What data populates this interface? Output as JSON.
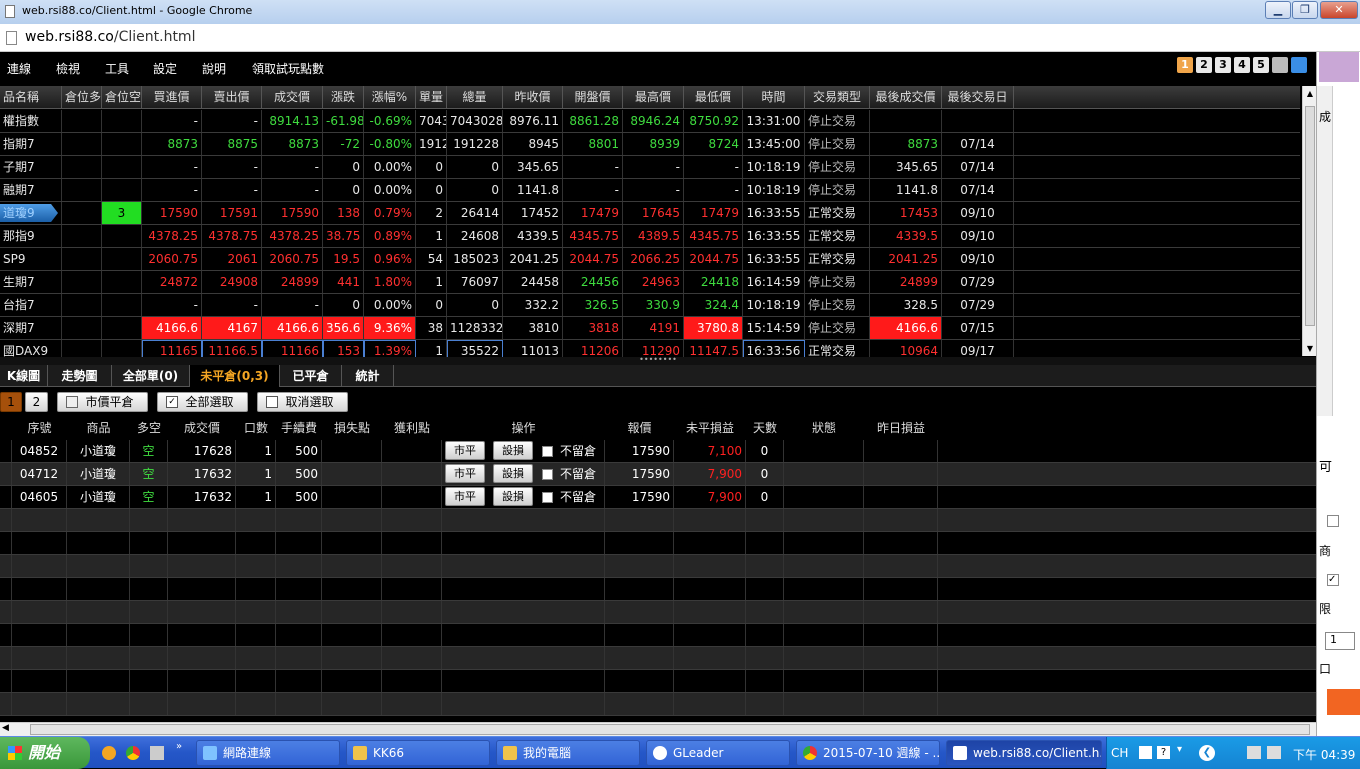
{
  "window": {
    "title": "web.rsi88.co/Client.html - Google Chrome",
    "url_host": "web.rsi88.co",
    "url_path": "/Client.html"
  },
  "menu": [
    "連線",
    "檢視",
    "工具",
    "設定",
    "說明",
    "領取試玩點數"
  ],
  "layout_buttons": [
    "1",
    "2",
    "3",
    "4",
    "5"
  ],
  "quote_headers": [
    "品名稱",
    "倉位多",
    "倉位空",
    "買進價",
    "賣出價",
    "成交價",
    "漲跌",
    "漲幅%",
    "單量",
    "總量",
    "昨收價",
    "開盤價",
    "最高價",
    "最低價",
    "時間",
    "交易類型",
    "最後成交價",
    "最後交易日"
  ],
  "quotes": [
    [
      "權指數",
      "",
      "",
      "-",
      "-",
      "8914.13",
      "-61.98",
      "-0.69%",
      "7043",
      "7043028",
      "8976.11",
      "8861.28",
      "8946.24",
      "8750.92",
      "13:31:00",
      "停止交易",
      "",
      ""
    ],
    [
      "指期7",
      "",
      "",
      "8873",
      "8875",
      "8873",
      "-72",
      "-0.80%",
      "1912",
      "191228",
      "8945",
      "8801",
      "8939",
      "8724",
      "13:45:00",
      "停止交易",
      "8873",
      "07/14"
    ],
    [
      "子期7",
      "",
      "",
      "-",
      "-",
      "-",
      "0",
      "0.00%",
      "0",
      "0",
      "345.65",
      "-",
      "-",
      "-",
      "10:18:19",
      "停止交易",
      "345.65",
      "07/14"
    ],
    [
      "融期7",
      "",
      "",
      "-",
      "-",
      "-",
      "0",
      "0.00%",
      "0",
      "0",
      "1141.8",
      "-",
      "-",
      "-",
      "10:18:19",
      "停止交易",
      "1141.8",
      "07/14"
    ],
    [
      "道瓊9",
      "",
      "3",
      "17590",
      "17591",
      "17590",
      "138",
      "0.79%",
      "2",
      "26414",
      "17452",
      "17479",
      "17645",
      "17479",
      "16:33:55",
      "正常交易",
      "17453",
      "09/10"
    ],
    [
      "那指9",
      "",
      "",
      "4378.25",
      "4378.75",
      "4378.25",
      "38.75",
      "0.89%",
      "1",
      "24608",
      "4339.5",
      "4345.75",
      "4389.5",
      "4345.75",
      "16:33:55",
      "正常交易",
      "4339.5",
      "09/10"
    ],
    [
      "SP9",
      "",
      "",
      "2060.75",
      "2061",
      "2060.75",
      "19.5",
      "0.96%",
      "54",
      "185023",
      "2041.25",
      "2044.75",
      "2066.25",
      "2044.75",
      "16:33:55",
      "正常交易",
      "2041.25",
      "09/10"
    ],
    [
      "生期7",
      "",
      "",
      "24872",
      "24908",
      "24899",
      "441",
      "1.80%",
      "1",
      "76097",
      "24458",
      "24456",
      "24963",
      "24418",
      "16:14:59",
      "停止交易",
      "24899",
      "07/29"
    ],
    [
      "台指7",
      "",
      "",
      "-",
      "-",
      "-",
      "0",
      "0.00%",
      "0",
      "0",
      "332.2",
      "326.5",
      "330.9",
      "324.4",
      "10:18:19",
      "停止交易",
      "328.5",
      "07/29"
    ],
    [
      "深期7",
      "",
      "",
      "4166.6",
      "4167",
      "4166.6",
      "356.6",
      "9.36%",
      "38",
      "1128332",
      "3810",
      "3818",
      "4191",
      "3780.8",
      "15:14:59",
      "停止交易",
      "4166.6",
      "07/15"
    ],
    [
      "國DAX9",
      "",
      "",
      "11165",
      "11166.5",
      "11166",
      "153",
      "1.39%",
      "1",
      "35522",
      "11013",
      "11206",
      "11290",
      "11147.5",
      "16:33:56",
      "正常交易",
      "10964",
      "09/17"
    ]
  ],
  "tabs": [
    "K線圖",
    "走勢圖",
    "全部單(0)",
    "未平倉(0,3)",
    "已平倉",
    "統計"
  ],
  "active_tab": "未平倉(0,3)",
  "page_buttons": [
    "1",
    "2"
  ],
  "action_buttons": {
    "market_close": "市價平倉",
    "select_all": "全部選取",
    "deselect": "取消選取"
  },
  "position_headers": [
    "序號",
    "商品",
    "多空",
    "成交價",
    "口數",
    "手續費",
    "損失點",
    "獲利點",
    "操作",
    "報價",
    "未平損益",
    "天數",
    "狀態",
    "昨日損益"
  ],
  "positions": [
    {
      "id": "04852",
      "product": "小道瓊",
      "side": "空",
      "price": "17628",
      "lots": "1",
      "fee": "500",
      "close_btn": "市平",
      "set_btn": "設損",
      "keep": "不留倉",
      "quote": "17590",
      "pnl": "7,100",
      "days": "0"
    },
    {
      "id": "04712",
      "product": "小道瓊",
      "side": "空",
      "price": "17632",
      "lots": "1",
      "fee": "500",
      "close_btn": "市平",
      "set_btn": "設損",
      "keep": "不留倉",
      "quote": "17590",
      "pnl": "7,900",
      "days": "0"
    },
    {
      "id": "04605",
      "product": "小道瓊",
      "side": "空",
      "price": "17632",
      "lots": "1",
      "fee": "500",
      "close_btn": "市平",
      "set_btn": "設損",
      "keep": "不留倉",
      "quote": "17590",
      "pnl": "7,900",
      "days": "0"
    }
  ],
  "taskbar": {
    "start": "開始",
    "items": [
      "網路連線",
      "KK66",
      "我的電腦",
      "GLeader",
      "2015-07-10 週線 - ...",
      "web.rsi88.co/Client.h..."
    ],
    "lang": "CH",
    "clock": "下午 04:39"
  },
  "right_pane": [
    "成",
    "可",
    "商",
    "限",
    "1",
    "口"
  ]
}
